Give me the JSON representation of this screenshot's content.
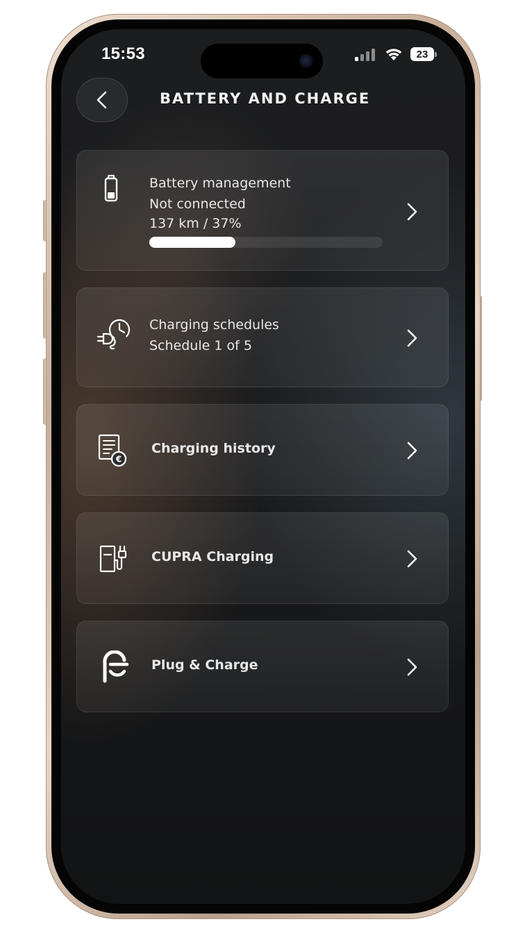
{
  "status_bar": {
    "time": "15:53",
    "battery_level": "23",
    "signal_icon": "cellular-signal-icon",
    "wifi_icon": "wifi-icon"
  },
  "header": {
    "back_icon": "chevron-left-icon",
    "title": "BATTERY AND CHARGE"
  },
  "cards": [
    {
      "icon": "battery-icon",
      "title": "Battery management",
      "status": "Not connected",
      "range": "137 km / 37%",
      "progress": 0.37
    },
    {
      "icon": "charging-schedule-icon",
      "title": "Charging schedules",
      "subtitle": "Schedule 1 of 5"
    },
    {
      "icon": "charging-history-icon",
      "title": "Charging history"
    },
    {
      "icon": "charging-station-icon",
      "title": "CUPRA Charging"
    },
    {
      "icon": "plug-and-charge-icon",
      "title": "Plug & Charge"
    }
  ],
  "colors": {
    "background": "#17191b",
    "text": "#e8e8e8",
    "progress_fill": "#ffffff"
  }
}
